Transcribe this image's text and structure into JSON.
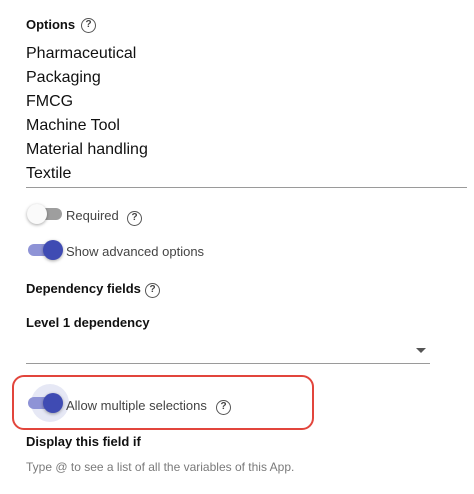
{
  "options_section": {
    "label": "Options",
    "help_icon": "?",
    "items": [
      "Pharmaceutical",
      "Packaging",
      "FMCG",
      "Machine Tool",
      "Material handling",
      "Textile"
    ]
  },
  "required_toggle": {
    "label": "Required",
    "checked": false,
    "help_icon": "?"
  },
  "advanced_toggle": {
    "label": "Show advanced options",
    "checked": true
  },
  "dependency_section": {
    "label": "Dependency fields",
    "help_icon": "?",
    "level1_label": "Level 1 dependency",
    "level1_value": ""
  },
  "multi_select_toggle": {
    "label": "Allow multiple selections",
    "checked": true,
    "help_icon": "?"
  },
  "display_section": {
    "label": "Display this field if",
    "hint": "Type @ to see a list of all the variables of this App."
  },
  "colors": {
    "toggle_on_thumb": "#3f4bb3",
    "toggle_on_track": "#8e93d6",
    "highlight_border": "#e2453c"
  }
}
